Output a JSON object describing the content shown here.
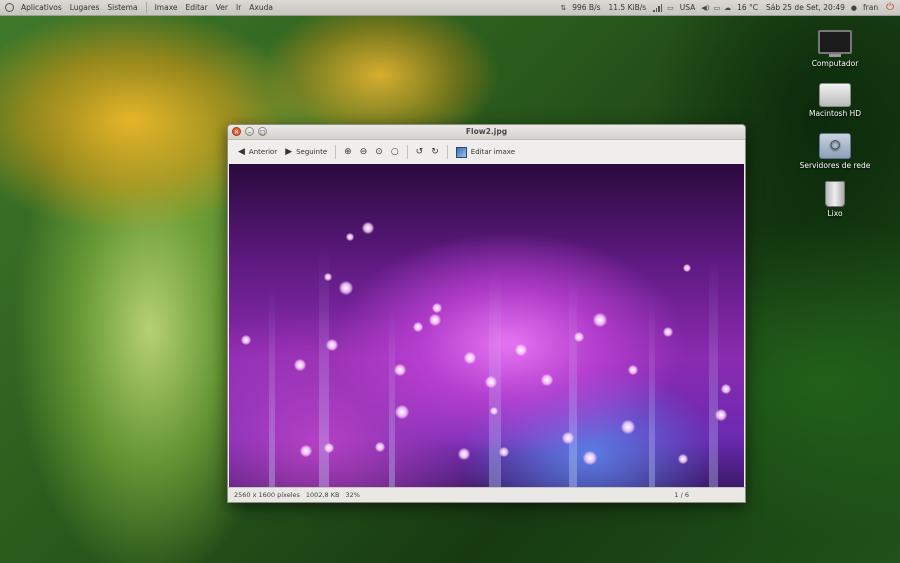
{
  "top_panel": {
    "menus": [
      "Aplicativos",
      "Lugares",
      "Sistema"
    ],
    "app_menus": [
      "Imaxe",
      "Editar",
      "Ver",
      "Ir",
      "Axuda"
    ],
    "indicators": {
      "download": "996 B/s",
      "upload": "11.5 KiB/s",
      "keyboard": "USA",
      "weather": "16 °C",
      "clock": "Sáb 25 de Set, 20:49",
      "user": "fran"
    },
    "icons": [
      "ubuntu-logo-icon",
      "download-icon",
      "network-signal-icon",
      "keyboard-icon",
      "volume-icon",
      "battery-icon",
      "weather-cloud-icon",
      "user-icon",
      "power-icon"
    ]
  },
  "desktop_icons": [
    {
      "label": "Computador",
      "icon": "computer-icon"
    },
    {
      "label": "Macintosh HD",
      "icon": "hard-drive-icon"
    },
    {
      "label": "Servidores de rede",
      "icon": "network-servers-icon"
    },
    {
      "label": "Lixo",
      "icon": "trash-icon"
    }
  ],
  "viewer": {
    "title": "Flow2.jpg",
    "toolbar": {
      "previous": "Anterior",
      "next": "Seguinte",
      "edit": "Editar imaxe"
    },
    "toolbar_icons": [
      "arrow-left-icon",
      "arrow-right-icon",
      "zoom-in-icon",
      "zoom-out-icon",
      "zoom-fit-icon",
      "zoom-original-icon",
      "rotate-left-icon",
      "rotate-right-icon",
      "edit-image-icon"
    ],
    "status": {
      "dimensions": "2560 x 1600 píxeles",
      "size": "1002,8 KB",
      "zoom": "32%",
      "counter": "1 / 6"
    }
  },
  "colors": {
    "panel": "#d6d4cf",
    "close_button": "#e55b2a",
    "image_purple": "#8a2bb0",
    "image_blue": "#5a8cf0"
  }
}
